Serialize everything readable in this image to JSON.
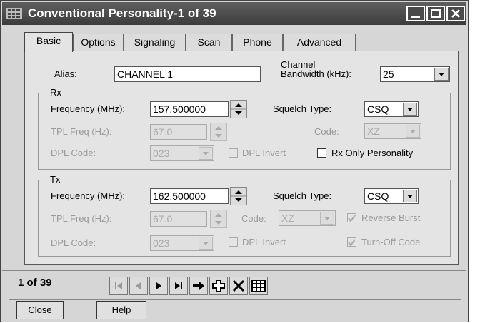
{
  "window": {
    "title": "Conventional Personality-1 of 39"
  },
  "tabs": [
    "Basic",
    "Options",
    "Signaling",
    "Scan",
    "Phone",
    "Advanced"
  ],
  "basic": {
    "alias_label": "Alias:",
    "alias_value": "CHANNEL 1",
    "bandwidth_label_line1": "Channel",
    "bandwidth_label_line2": "Bandwidth (kHz):",
    "bandwidth_value": "25",
    "rx": {
      "group_label": "Rx",
      "freq_label": "Frequency (MHz):",
      "freq_value": "157.500000",
      "squelch_label": "Squelch Type:",
      "squelch_value": "CSQ",
      "tpl_label": "TPL Freq (Hz):",
      "tpl_value": "67.0",
      "code_label": "Code:",
      "code_value": "XZ",
      "dpl_label": "DPL Code:",
      "dpl_value": "023",
      "dpl_invert_label": "DPL Invert",
      "rx_only_label": "Rx Only Personality"
    },
    "tx": {
      "group_label": "Tx",
      "freq_label": "Frequency (MHz):",
      "freq_value": "162.500000",
      "squelch_label": "Squelch Type:",
      "squelch_value": "CSQ",
      "tpl_label": "TPL Freq (Hz):",
      "tpl_value": "67.0",
      "code_label": "Code:",
      "code_value": "XZ",
      "reverse_burst_label": "Reverse Burst",
      "dpl_label": "DPL Code:",
      "dpl_value": "023",
      "dpl_invert_label": "DPL Invert",
      "turn_off_label": "Turn-Off Code"
    }
  },
  "footer": {
    "record_counter": "1 of 39",
    "close_label": "Close",
    "help_label": "Help"
  },
  "colors": {
    "titlebar": "#4a4a4a",
    "window_bg": "#d6d6d6",
    "panel_bg": "#e4e4e4"
  }
}
